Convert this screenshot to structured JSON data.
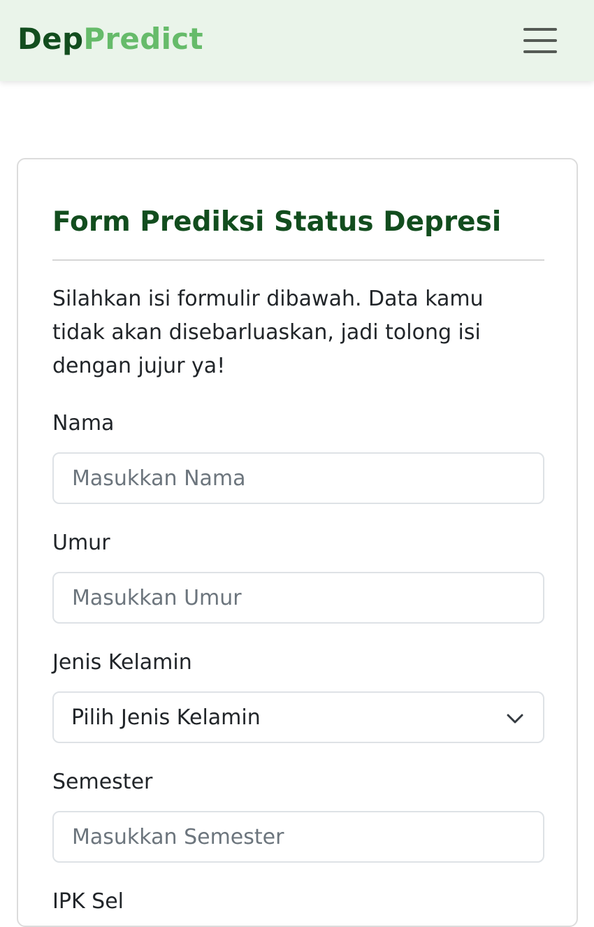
{
  "navbar": {
    "brand_part1": "Dep",
    "brand_part2": "Predict",
    "menu_icon": "hamburger-menu-icon"
  },
  "form": {
    "title": "Form Prediksi Status Depresi",
    "intro": "Silahkan isi formulir dibawah. Data kamu tidak akan disebarluaskan, jadi tolong isi dengan jujur ya!",
    "fields": {
      "nama": {
        "label": "Nama",
        "placeholder": "Masukkan Nama"
      },
      "umur": {
        "label": "Umur",
        "placeholder": "Masukkan Umur"
      },
      "jenis_kelamin": {
        "label": "Jenis Kelamin",
        "selected": "Pilih Jenis Kelamin",
        "icon": "chevron-down-icon"
      },
      "semester": {
        "label": "Semester",
        "placeholder": "Masukkan Semester"
      },
      "ipk": {
        "label": "IPK Sel"
      }
    }
  },
  "colors": {
    "brand_dark": "#124d1e",
    "brand_light": "#66bb6a",
    "navbar_bg": "#eaf4ea"
  }
}
